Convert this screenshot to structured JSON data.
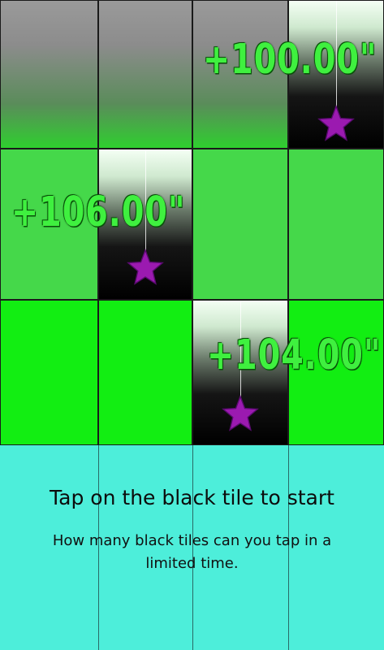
{
  "start_panel": {
    "title": "Tap on the black tile to start",
    "subtitle": "How many black tiles can you tap in a limited time."
  },
  "bonuses": [
    "+100.00\"",
    "+106.00\"",
    "+104.00\""
  ],
  "colors": {
    "top_row": "#8c8c8c",
    "mid_row": "#45d84a",
    "bottom_row": "#12ee12",
    "start_panel": "#4deeda",
    "star": "#9b1ab0",
    "bonus_text": "#3ff03f"
  },
  "icons": {
    "star": "star-icon"
  }
}
